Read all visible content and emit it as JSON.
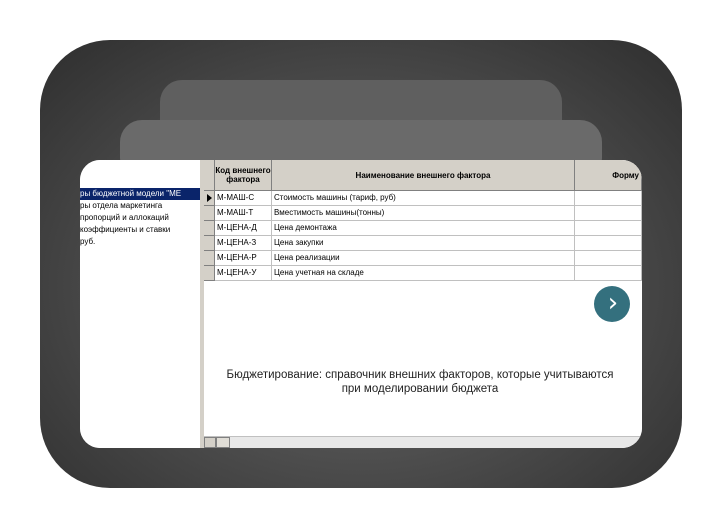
{
  "tree": {
    "items": [
      {
        "label": "ры бюджетной модели \"МЕ",
        "selected": true
      },
      {
        "label": "ры отдела маркетинга",
        "selected": false
      },
      {
        "label": "пропорций и аллокаций",
        "selected": false
      },
      {
        "label": "коэффициенты и ставки",
        "selected": false
      },
      {
        "label": "руб.",
        "selected": false
      }
    ]
  },
  "table": {
    "headers": [
      "Код внешнего фактора",
      "Наименование внешнего фактора",
      "Форму"
    ],
    "rows": [
      {
        "code": "М-МАШ-С",
        "name": "Стоимость машины (тариф, руб)"
      },
      {
        "code": "М-МАШ-Т",
        "name": "Вместимость машины(тонны)"
      },
      {
        "code": "М-ЦЕНА-Д",
        "name": "Цена демонтажа"
      },
      {
        "code": "М-ЦЕНА-З",
        "name": "Цена закупки"
      },
      {
        "code": "М-ЦЕНА-Р",
        "name": "Цена реализации"
      },
      {
        "code": "М-ЦЕНА-У",
        "name": "Цена учетная на складе"
      }
    ]
  },
  "caption": "Бюджетирование: справочник внешних факторов, которые учитываются при моделировании бюджета",
  "next_button": {
    "icon": "chevron-right-icon",
    "glyph": "›"
  },
  "colors": {
    "accent": "#34707e",
    "selection": "#0a246a",
    "header": "#d4d0c8"
  }
}
